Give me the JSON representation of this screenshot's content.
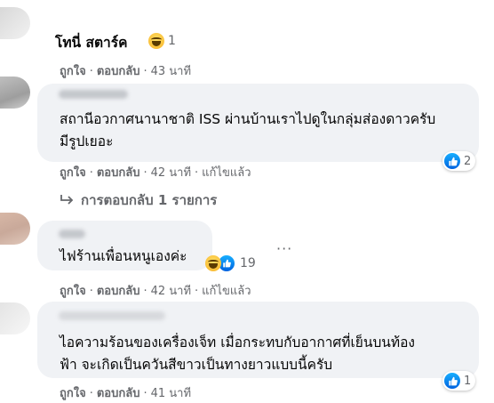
{
  "colors": {
    "bubble": "#f0f2f5",
    "secondary_text": "#65676b",
    "primary_text": "#050505",
    "like_blue": "#1877f2",
    "haha_yellow": "#f7b125"
  },
  "comments": [
    {
      "author": "โทนี่ สตาร์ค",
      "text": "",
      "reaction_icons": [
        "haha-icon"
      ],
      "reaction_count": "1",
      "actions": {
        "like": "ถูกใจ",
        "reply": "ตอบกลับ",
        "time": "43 นาที"
      }
    },
    {
      "author": "",
      "text": "สถานีอวกาศนานาชาติ ISS ผ่านบ้านเราไปดูในกลุ่มส่องดาวครับ\nมีรูปเยอะ",
      "reaction_icons": [
        "like-icon"
      ],
      "reaction_count": "2",
      "actions": {
        "like": "ถูกใจ",
        "reply": "ตอบกลับ",
        "time": "42 นาที",
        "edited": "แก้ไขแล้ว"
      },
      "replies_link": "การตอบกลับ 1 รายการ"
    },
    {
      "author": "",
      "text": "ไฟร้านเพื่อนหนูเองค่ะ",
      "reaction_icons": [
        "haha-icon",
        "like-icon"
      ],
      "reaction_count": "19",
      "actions": {
        "like": "ถูกใจ",
        "reply": "ตอบกลับ",
        "time": "42 นาที",
        "edited": "แก้ไขแล้ว"
      }
    },
    {
      "author": "",
      "text": "ไอความร้อนของเครื่องเจ็ท เมื่อกระทบกับอากาศที่เย็นบนท้อง\nฟ้า จะเกิดเป็นควันสีขาวเป็นทางยาวแบบนี้ครับ",
      "reaction_icons": [
        "like-icon"
      ],
      "reaction_count": "1",
      "actions": {
        "like": "ถูกใจ",
        "reply": "ตอบกลับ",
        "time": "41 นาที"
      }
    }
  ],
  "more_icon": "more-options-icon"
}
